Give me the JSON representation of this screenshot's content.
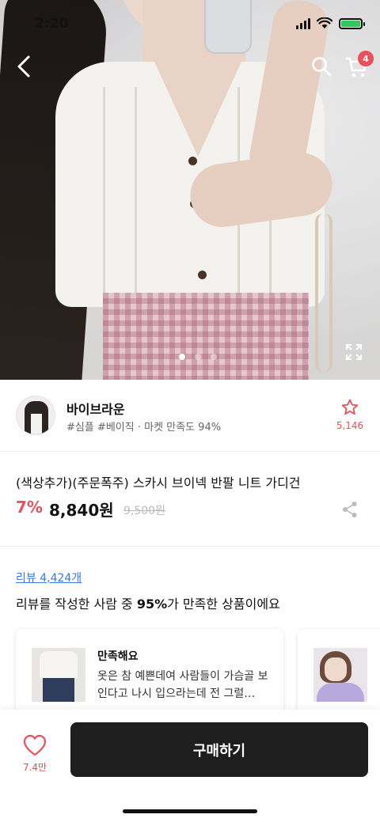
{
  "status_bar": {
    "time": "2:20"
  },
  "nav": {
    "cart_count": "4"
  },
  "gallery": {
    "page_count": 3,
    "active_index": 0
  },
  "shop": {
    "name": "바이브라운",
    "tags": "#심플 #베이직 · 마켓 만족도 94%",
    "favorite_count": "5,146"
  },
  "product": {
    "title": "(색상추가)(주문폭주) 스카시 브이넥 반팔 니트 가디건",
    "discount": "7%",
    "price": "8,840원",
    "original_price": "9,500원"
  },
  "reviews": {
    "link_label": "리뷰 4,424개",
    "summary_prefix": "리뷰를 작성한 사람 중 ",
    "summary_percent": "95%",
    "summary_suffix": "가 만족한 상품이에요",
    "cards": [
      {
        "title": "만족해요",
        "body": "옷은 참 예쁜데여 사람들이 가슴골 보인다고 나시 입으라는데 전 그럴…"
      }
    ]
  },
  "bottom_bar": {
    "like_count": "7.4만",
    "buy_label": "구매하기"
  },
  "colors": {
    "accent": "#e8505b",
    "link": "#3a78e0",
    "buy_button": "#1e1e1e"
  },
  "icons": [
    "back-arrow-icon",
    "search-icon",
    "cart-icon",
    "expand-icon",
    "star-icon",
    "share-icon",
    "heart-icon"
  ]
}
